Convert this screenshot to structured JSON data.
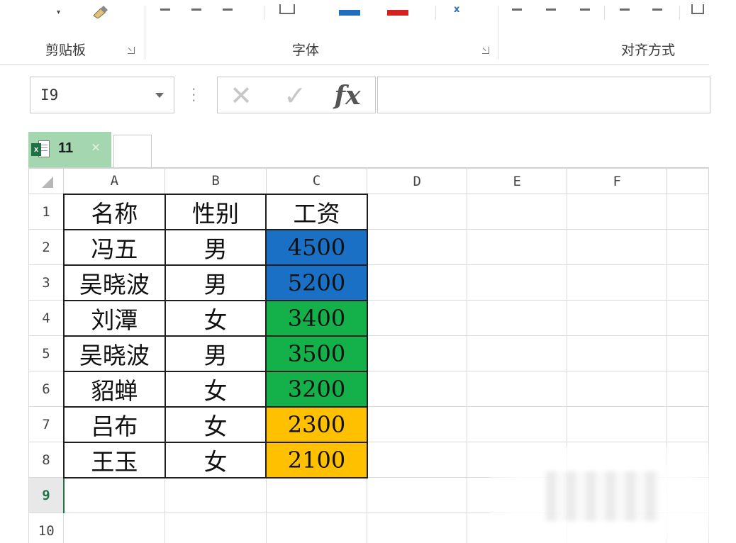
{
  "ribbon": {
    "groups": [
      {
        "label": "剪贴板"
      },
      {
        "label": "字体"
      },
      {
        "label": "对齐方式"
      }
    ]
  },
  "formula_bar": {
    "name_box": "I9",
    "formula_value": ""
  },
  "sheet_tab": {
    "label": "11",
    "close": "×"
  },
  "grid": {
    "columns": [
      "A",
      "B",
      "C",
      "D",
      "E",
      "F"
    ],
    "rows": [
      {
        "num": "1",
        "cells": [
          "名称",
          "性别",
          "工资"
        ]
      },
      {
        "num": "2",
        "cells": [
          "冯五",
          "男",
          "4500"
        ]
      },
      {
        "num": "3",
        "cells": [
          "吴晓波",
          "男",
          "5200"
        ]
      },
      {
        "num": "4",
        "cells": [
          "刘潭",
          "女",
          "3400"
        ]
      },
      {
        "num": "5",
        "cells": [
          "吴晓波",
          "男",
          "3500"
        ]
      },
      {
        "num": "6",
        "cells": [
          "貂蝉",
          "女",
          "3200"
        ]
      },
      {
        "num": "7",
        "cells": [
          "吕布",
          "女",
          "2300"
        ]
      },
      {
        "num": "8",
        "cells": [
          "王玉",
          "女",
          "2100"
        ]
      },
      {
        "num": "9",
        "cells": [
          "",
          "",
          ""
        ]
      },
      {
        "num": "10",
        "cells": [
          "",
          "",
          ""
        ]
      }
    ],
    "active_row": "9",
    "salary_fill_colors": {
      "blue": "#1970c4",
      "green": "#14b04a",
      "orange": "#ffc000"
    }
  }
}
